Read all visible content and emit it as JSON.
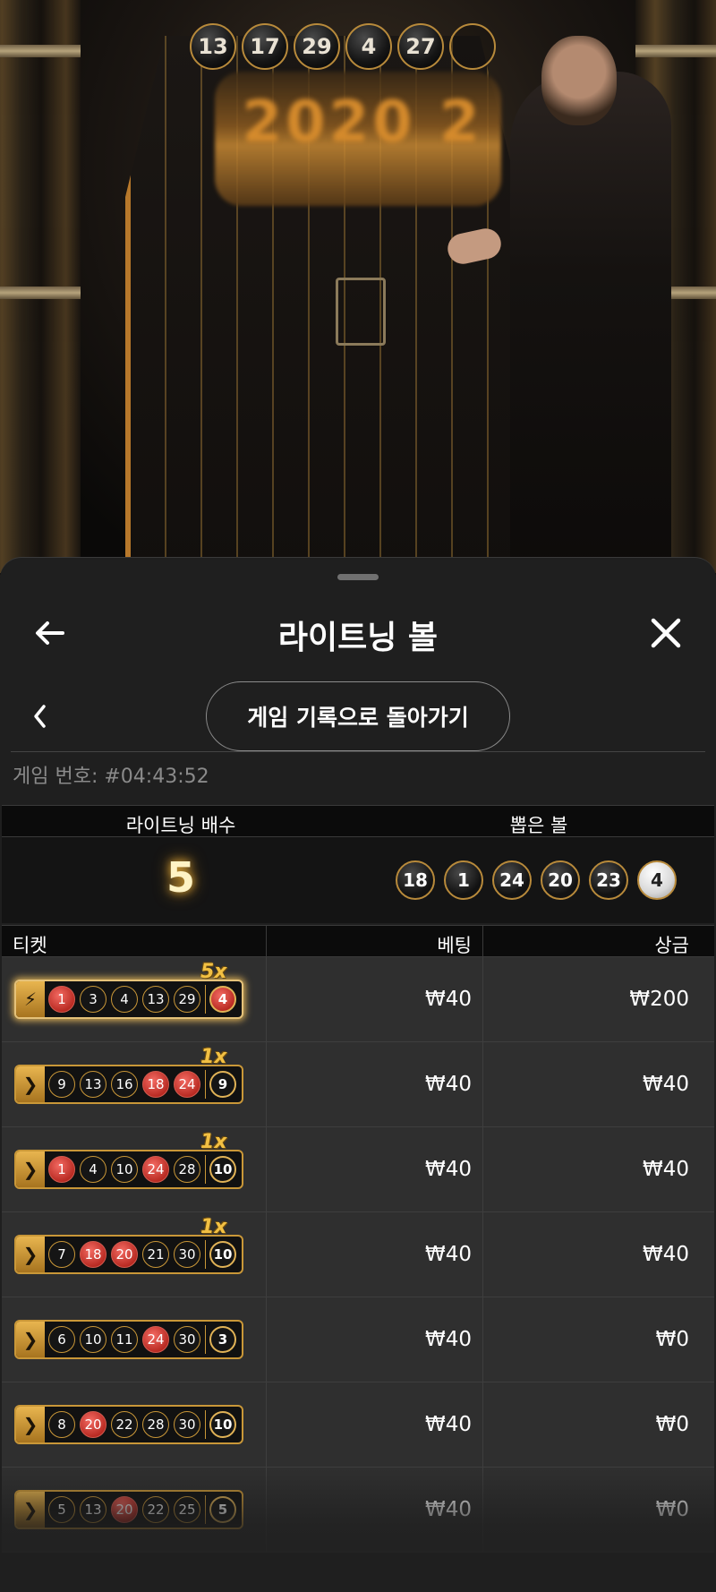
{
  "stage": {
    "top_balls": [
      "13",
      "17",
      "29",
      "4",
      "27",
      ""
    ],
    "drum_text": "2020 2"
  },
  "sheet": {
    "title": "라이트닝 볼",
    "back_to_history_label": "게임 기록으로 돌아가기",
    "game_number_label": "게임 번호: #04:43:52"
  },
  "result": {
    "multiplier_header": "라이트닝 배수",
    "drawn_header": "뽑은 볼",
    "multiplier_value": "5",
    "drawn_balls": [
      "18",
      "1",
      "24",
      "20",
      "23",
      "4"
    ],
    "lit_ball": "4"
  },
  "table": {
    "col_ticket": "티켓",
    "col_bet": "베팅",
    "col_prize": "상금",
    "rows": [
      {
        "type": "lightning",
        "numbers": [
          "1",
          "3",
          "4",
          "13",
          "29"
        ],
        "hits": [
          true,
          false,
          false,
          false,
          false
        ],
        "bonus": "4",
        "bonus_hit": true,
        "multiplier": "5x",
        "bet": "₩40",
        "prize": "₩200"
      },
      {
        "type": "standard",
        "numbers": [
          "9",
          "13",
          "16",
          "18",
          "24"
        ],
        "hits": [
          false,
          false,
          false,
          true,
          true
        ],
        "bonus": "9",
        "bonus_hit": false,
        "multiplier": "1x",
        "bet": "₩40",
        "prize": "₩40"
      },
      {
        "type": "standard",
        "numbers": [
          "1",
          "4",
          "10",
          "24",
          "28"
        ],
        "hits": [
          true,
          false,
          false,
          true,
          false
        ],
        "bonus": "10",
        "bonus_hit": false,
        "multiplier": "1x",
        "bet": "₩40",
        "prize": "₩40"
      },
      {
        "type": "standard",
        "numbers": [
          "7",
          "18",
          "20",
          "21",
          "30"
        ],
        "hits": [
          false,
          true,
          true,
          false,
          false
        ],
        "bonus": "10",
        "bonus_hit": false,
        "multiplier": "1x",
        "bet": "₩40",
        "prize": "₩40"
      },
      {
        "type": "standard",
        "numbers": [
          "6",
          "10",
          "11",
          "24",
          "30"
        ],
        "hits": [
          false,
          false,
          false,
          true,
          false
        ],
        "bonus": "3",
        "bonus_hit": false,
        "multiplier": "",
        "bet": "₩40",
        "prize": "₩0"
      },
      {
        "type": "standard",
        "numbers": [
          "8",
          "20",
          "22",
          "28",
          "30"
        ],
        "hits": [
          false,
          true,
          false,
          false,
          false
        ],
        "bonus": "10",
        "bonus_hit": false,
        "multiplier": "",
        "bet": "₩40",
        "prize": "₩0"
      },
      {
        "type": "standard",
        "numbers": [
          "5",
          "13",
          "20",
          "22",
          "25"
        ],
        "hits": [
          false,
          false,
          true,
          false,
          false
        ],
        "bonus": "5",
        "bonus_hit": false,
        "multiplier": "",
        "bet": "₩40",
        "prize": "₩0"
      }
    ]
  },
  "colors": {
    "gold": "#c99738",
    "hit_red": "#d0342a",
    "sheet_bg": "#1f1f1f"
  }
}
